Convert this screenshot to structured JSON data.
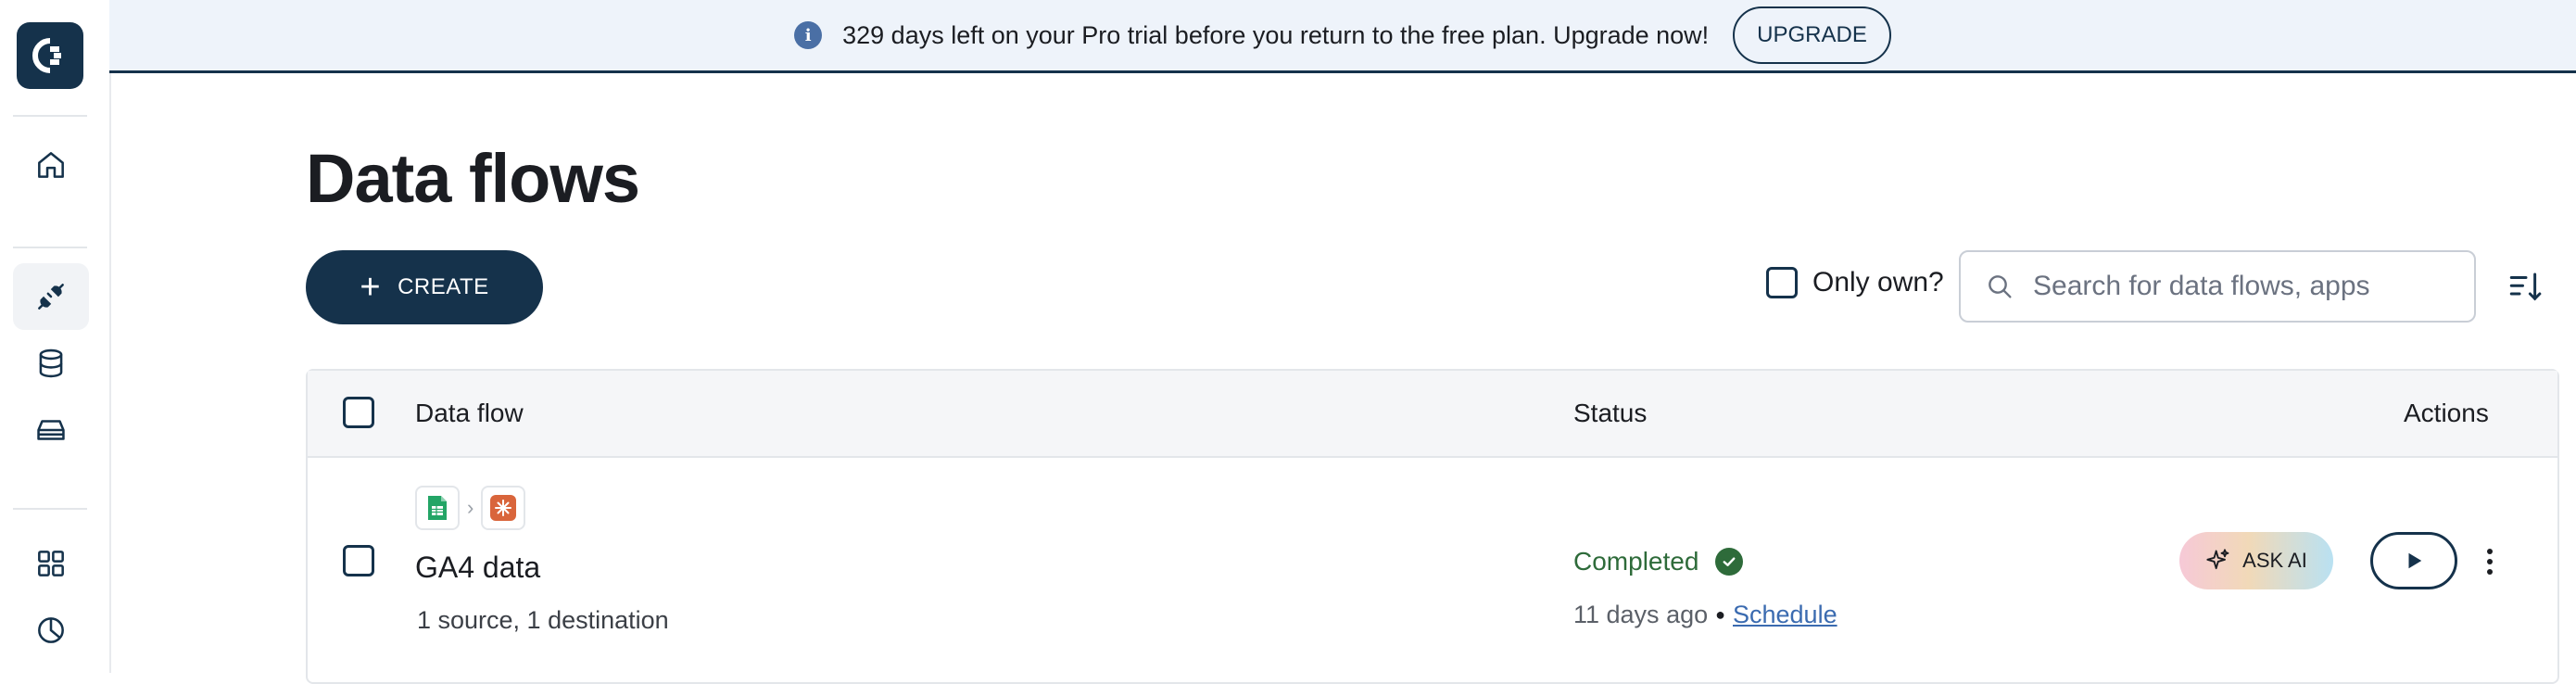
{
  "banner": {
    "message": "329 days left on your Pro trial before you return to the free plan. Upgrade now!",
    "upgrade_label": "UPGRADE"
  },
  "sidebar": {
    "items": [
      {
        "name": "home",
        "icon": "home-icon"
      },
      {
        "name": "data-flows",
        "icon": "plug-icon",
        "active": true
      },
      {
        "name": "sources",
        "icon": "database-icon"
      },
      {
        "name": "storage",
        "icon": "storage-icon"
      },
      {
        "name": "apps",
        "icon": "grid-icon"
      },
      {
        "name": "reports",
        "icon": "pie-chart-icon"
      }
    ]
  },
  "page": {
    "title": "Data flows",
    "create_label": "CREATE",
    "only_own_label": "Only own?",
    "search_placeholder": "Search for data flows, apps"
  },
  "table": {
    "columns": {
      "flow": "Data flow",
      "status": "Status",
      "actions": "Actions"
    },
    "rows": [
      {
        "name": "GA4 data",
        "subtitle": "1 source, 1 destination",
        "status": "Completed",
        "time_ago": "11 days ago",
        "separator": "●",
        "schedule_label": "Schedule",
        "ask_ai_label": "ASK AI"
      }
    ]
  },
  "colors": {
    "primary": "#15324b",
    "banner_bg": "#eef3fa",
    "success": "#2e6b3a",
    "link": "#3b6bb0"
  }
}
